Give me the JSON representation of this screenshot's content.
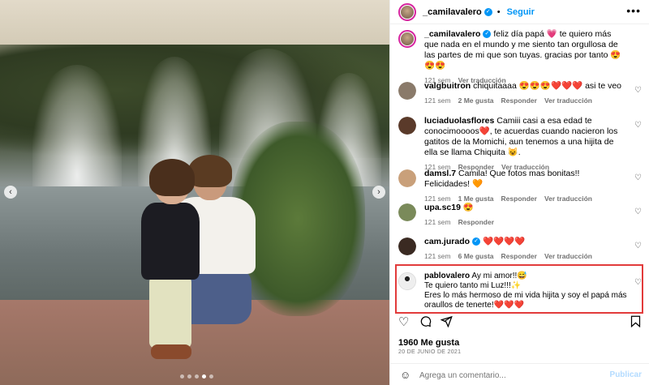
{
  "post": {
    "username": "_camilavalero",
    "follow_label": "Seguir",
    "caption_user": "_camilavalero",
    "caption_text": "feliz día papá 💗 te quiero más que nada en el mundo y me siento tan orgullosa de las partes de mi que son tuyas. gracias por tanto 😍😍😍",
    "caption_time": "121 sem",
    "caption_translate": "Ver traducción",
    "likes": "1960 Me gusta",
    "date": "20 DE JUNIO DE 2021",
    "add_comment_placeholder": "Agrega un comentario...",
    "publish_label": "Publicar",
    "carousel": {
      "count": 5,
      "active_index": 3,
      "prev_icon": "chevron-left-icon",
      "next_icon": "chevron-right-icon"
    }
  },
  "comments": [
    {
      "user": "valgbuitron",
      "text": "chiquitaaaa 😍😍😍❤️❤️❤️ asi te veo",
      "time": "121 sem",
      "likes": "2 Me gusta",
      "reply": "Responder",
      "translate": "Ver traducción",
      "avatar_color": "#8a7a6a"
    },
    {
      "user": "luciaduolasflores",
      "text": "Camiii casi a esa edad te conocimoooos❤️, te acuerdas cuando nacieron los gatitos de la Momichi, aun tenemos a una hijita de ella se llama Chiquita 😺.",
      "time": "121 sem",
      "likes": "",
      "reply": "Responder",
      "translate": "Ver traducción",
      "avatar_color": "#5a3a2a"
    },
    {
      "user": "damsl.7",
      "text": "Camila! Que fotos mas bonitas!! Felicidades! 🧡",
      "time": "121 sem",
      "likes": "1 Me gusta",
      "reply": "Responder",
      "translate": "Ver traducción",
      "avatar_color": "#c9a07a"
    },
    {
      "user": "upa.sc19",
      "text": "😍",
      "time": "121 sem",
      "likes": "",
      "reply": "Responder",
      "translate": "",
      "avatar_color": "#7a8a5a"
    },
    {
      "user": "cam.jurado",
      "text": "❤️❤️❤️❤️",
      "time": "121 sem",
      "likes": "6 Me gusta",
      "reply": "Responder",
      "translate": "Ver traducción",
      "avatar_color": "#3a2a22",
      "verified": true
    },
    {
      "user": "pablovalero",
      "text_line1": "Ay mi amor!!😅",
      "text_line2": "Te quiero tanto mi Luz!!!✨",
      "text_line3": "Eres lo más hermoso de mi vida hijita y soy el papá más oraullos de tenerte!❤️❤️❤️",
      "avatar_color": "#e9e9e9"
    }
  ],
  "icons": {
    "more": "more-options-icon",
    "heart": "heart-icon",
    "comment": "comment-icon",
    "share": "share-icon",
    "save": "bookmark-icon",
    "emoji": "emoji-icon",
    "verified": "verified-badge-icon"
  },
  "colors": {
    "accent": "#0095f6",
    "highlight_border": "#e23b3b",
    "meta_text": "#737373"
  }
}
